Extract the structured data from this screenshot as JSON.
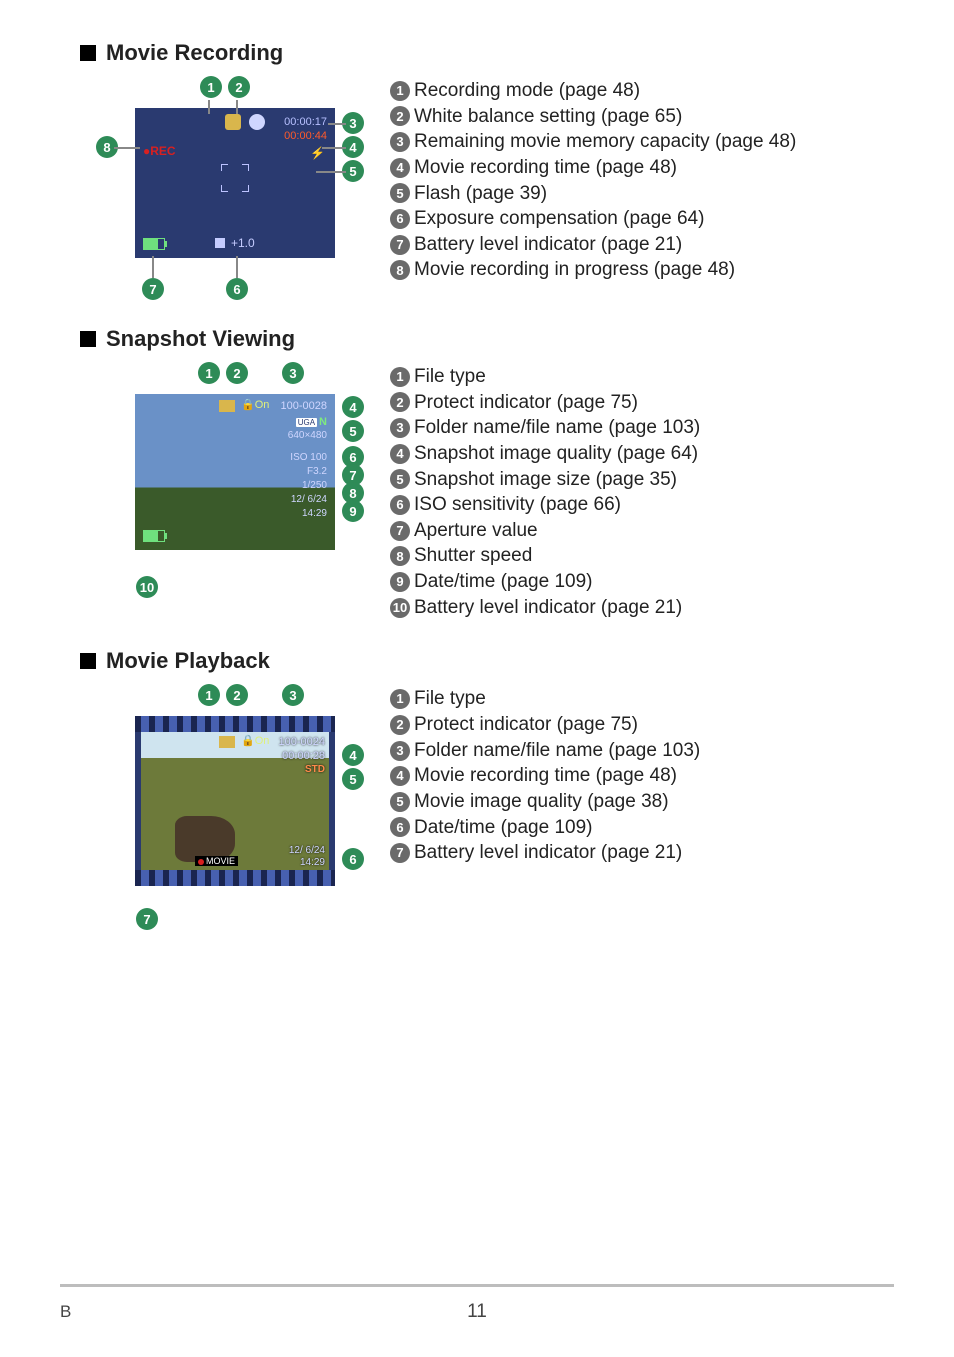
{
  "page_number": "11",
  "footer_left": "B",
  "sections": {
    "movie_recording": {
      "title": "Movie Recording",
      "screen": {
        "rec_time": "00:00:17",
        "rem_time": "00:00:44",
        "flash": "⚡",
        "rec_label": "●REC",
        "ev_value": "+1.0",
        "ev_icon": "◪"
      },
      "items": [
        "Recording mode (page 48)",
        "White balance setting (page 65)",
        "Remaining movie memory capacity (page 48)",
        "Movie recording time (page 48)",
        "Flash (page 39)",
        "Exposure compensation (page 64)",
        "Battery level indicator (page 21)",
        "Movie recording in progress (page 48)"
      ]
    },
    "snapshot_viewing": {
      "title": "Snapshot Viewing",
      "screen": {
        "protect": "On",
        "folder_file": "100-0028",
        "quality_box": "UGA",
        "quality_letter": "N",
        "resolution": "640×480",
        "iso": "ISO 100",
        "aperture": "F3.2",
        "shutter": "1/250",
        "date": "12/ 6/24",
        "time": "14:29"
      },
      "items": [
        "File type",
        "Protect indicator (page 75)",
        "Folder name/file name (page 103)",
        "Snapshot image quality (page 64)",
        "Snapshot image size (page 35)",
        "ISO sensitivity (page 66)",
        "Aperture value",
        "Shutter speed",
        "Date/time (page 109)",
        "Battery level indicator (page 21)"
      ]
    },
    "movie_playback": {
      "title": "Movie Playback",
      "screen": {
        "protect": "On",
        "folder_file": "100-0024",
        "rec_time": "00:00:28",
        "quality": "STD",
        "date": "12/ 6/24",
        "time": "14:29",
        "movie_label": "MOVIE"
      },
      "items": [
        "File type",
        "Protect indicator (page 75)",
        "Folder name/file name (page 103)",
        "Movie recording time (page 48)",
        "Movie image quality (page 38)",
        "Date/time (page 109)",
        "Battery level indicator (page 21)"
      ]
    }
  }
}
